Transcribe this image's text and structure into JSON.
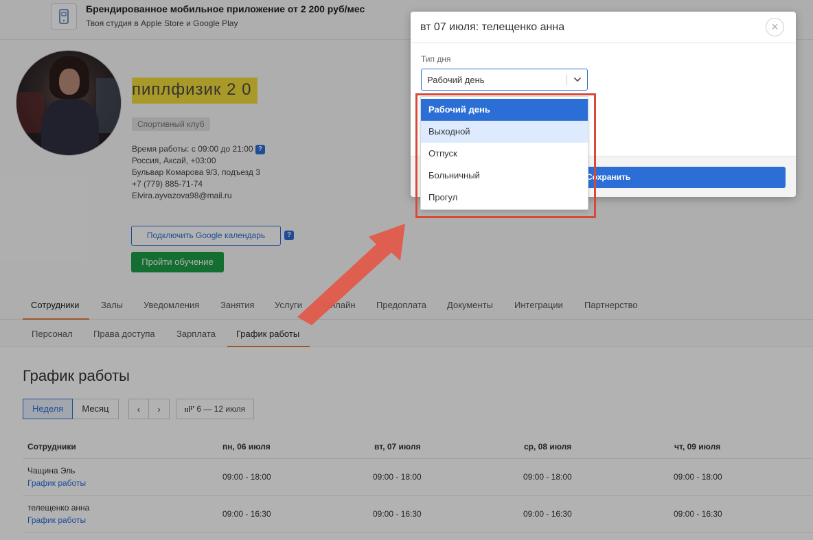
{
  "banner": {
    "title": "Брендированное мобильное приложение от 2 200 руб/мес",
    "subtitle": "Твоя студия в Apple Store и Google Play"
  },
  "profile": {
    "club_name": "пиплфизик 2 0",
    "club_type": "Спортивный клуб",
    "hours": "Время работы: с 09:00 до 21:00",
    "help_mark": "?",
    "location": "Россия, Аксай, +03:00",
    "address": "Бульвар Комарова 9/3, подъезд 3",
    "phone": "+7 (779) 885-71-74",
    "email": "Elvira.ayvazova98@mail.ru",
    "google_calendar_button": "Подключить Google календарь",
    "training_button": "Пройти обучение"
  },
  "main_tabs": [
    {
      "label": "Сотрудники"
    },
    {
      "label": "Залы"
    },
    {
      "label": "Уведомления"
    },
    {
      "label": "Занятия"
    },
    {
      "label": "Услуги"
    },
    {
      "label": "Онлайн"
    },
    {
      "label": "Предоплата"
    },
    {
      "label": "Документы"
    },
    {
      "label": "Интеграции"
    },
    {
      "label": "Партнерство"
    }
  ],
  "sub_tabs": [
    {
      "label": "Персонал"
    },
    {
      "label": "Права доступа"
    },
    {
      "label": "Зарплата"
    },
    {
      "label": "График работы"
    }
  ],
  "schedule": {
    "title": "График работы",
    "view_week": "Неделя",
    "view_month": "Месяц",
    "prev": "‹",
    "next": "›",
    "date_range": "6 — 12 июля",
    "columns": [
      "Сотрудники",
      "пн, 06 июля",
      "вт, 07 июля",
      "ср, 08 июля",
      "чт, 09 июля"
    ],
    "rows": [
      {
        "name": "Чащина Эль",
        "link": "График работы",
        "cells": [
          "09:00 - 18:00",
          "09:00 - 18:00",
          "09:00 - 18:00",
          "09:00 - 18:00"
        ]
      },
      {
        "name": "телещенко анна",
        "link": "График работы",
        "cells": [
          "09:00 - 16:30",
          "09:00 - 16:30",
          "09:00 - 16:30",
          "09:00 - 16:30"
        ]
      }
    ]
  },
  "modal": {
    "title": "вт 07 июля: телещенко анна",
    "close": "×",
    "day_type_label": "Тип дня",
    "day_type_value": "Рабочий день",
    "save_button": "Сохранить",
    "options": [
      {
        "label": "Рабочий день",
        "state": "selected"
      },
      {
        "label": "Выходной",
        "state": "hover"
      },
      {
        "label": "Отпуск",
        "state": "normal"
      },
      {
        "label": "Больничный",
        "state": "normal"
      },
      {
        "label": "Прогул",
        "state": "normal"
      }
    ]
  },
  "colors": {
    "accent": "#2b6fd6",
    "success": "#1e9e47",
    "club_name_highlight": "#f2dc3c",
    "tab_underline": "#e07a3a",
    "annotation": "#d9493a"
  },
  "icons": {
    "banner": "mobile-app-icon",
    "close": "close-icon",
    "chevron": "chevron-down-icon",
    "calendar": "calendar-icon",
    "annotation_arrow": "arrow-icon"
  }
}
